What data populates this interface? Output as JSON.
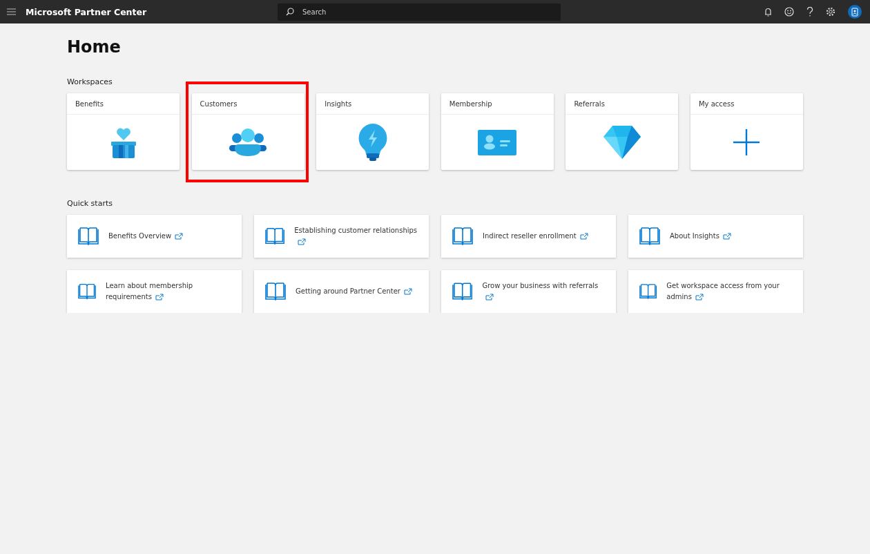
{
  "header": {
    "title": "Microsoft Partner Center",
    "search": {
      "placeholder": "Search"
    }
  },
  "page": {
    "title": "Home"
  },
  "workspaces": {
    "heading": "Workspaces",
    "items": [
      {
        "label": "Benefits",
        "kind": "benefits",
        "highlighted": false
      },
      {
        "label": "Customers",
        "kind": "customers",
        "highlighted": true
      },
      {
        "label": "Insights",
        "kind": "insights",
        "highlighted": false
      },
      {
        "label": "Membership",
        "kind": "membership",
        "highlighted": false
      },
      {
        "label": "Referrals",
        "kind": "referrals",
        "highlighted": false
      },
      {
        "label": "My access",
        "kind": "add",
        "highlighted": false
      }
    ]
  },
  "quick_starts": {
    "heading": "Quick starts",
    "items": [
      {
        "label": "Benefits Overview"
      },
      {
        "label": "Establishing customer relationships"
      },
      {
        "label": "Indirect reseller enrollment"
      },
      {
        "label": "About Insights"
      },
      {
        "label": "Learn about membership requirements"
      },
      {
        "label": "Getting around Partner Center"
      },
      {
        "label": "Grow your business with referrals"
      },
      {
        "label": "Get workspace access from your admins"
      }
    ]
  }
}
